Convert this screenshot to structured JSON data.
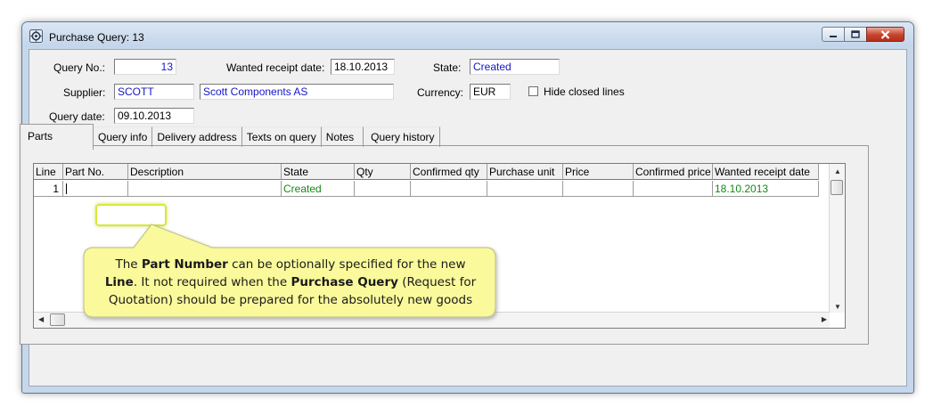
{
  "window": {
    "title": "Purchase Query: 13",
    "controls": {
      "minimize": "minimize",
      "maximize": "maximize",
      "close": "close"
    }
  },
  "header": {
    "query_no_label": "Query No.:",
    "query_no": "13",
    "wanted_receipt_label": "Wanted receipt date:",
    "wanted_receipt_date": "18.10.2013",
    "state_label": "State:",
    "state": "Created",
    "supplier_label": "Supplier:",
    "supplier_code": "SCOTT",
    "supplier_name": "Scott Components AS",
    "currency_label": "Currency:",
    "currency": "EUR",
    "hide_closed_label": "Hide closed lines",
    "hide_closed_checked": false,
    "query_date_label": "Query date:",
    "query_date": "09.10.2013"
  },
  "tabs": [
    {
      "label": "Parts",
      "active": true
    },
    {
      "label": "Query info",
      "active": false
    },
    {
      "label": "Delivery address",
      "active": false
    },
    {
      "label": "Texts on query",
      "active": false
    },
    {
      "label": "Notes",
      "active": false
    },
    {
      "label": "Query history",
      "active": false
    }
  ],
  "grid": {
    "columns": [
      "Line",
      "Part No.",
      "Description",
      "State",
      "Qty",
      "Confirmed qty",
      "Purchase unit",
      "Price",
      "Confirmed price",
      "Wanted receipt date"
    ],
    "rows": [
      [
        "1",
        "",
        "",
        "Created",
        "",
        "",
        "",
        "",
        "",
        "18.10.2013"
      ]
    ]
  },
  "callout": {
    "t1": "The ",
    "b1": "Part Number",
    "t2": " can be optionally specified for the new",
    "b2": "Line",
    "t3": ". It not required when the ",
    "b3": "Purchase Query",
    "t4": " (Request for",
    "t5": "Quotation) should be prepared for the absolutely new goods"
  },
  "colors": {
    "blue_text": "#1515c8",
    "green_text": "#138a13",
    "callout_fill": "#fafa9c",
    "highlight": "#d6e83a"
  }
}
